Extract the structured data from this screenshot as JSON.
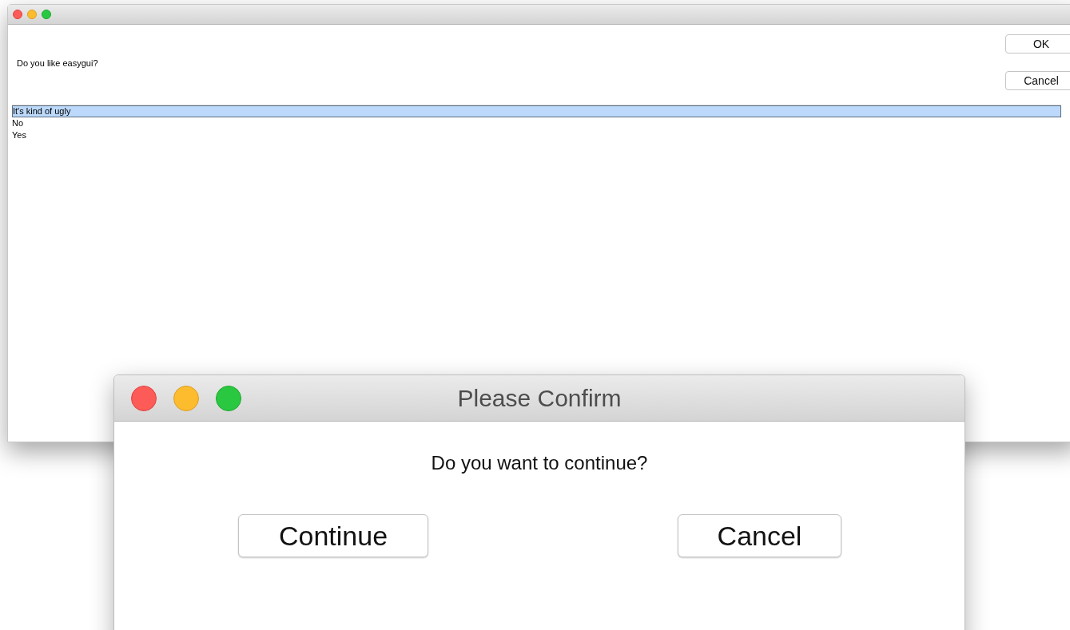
{
  "back_window": {
    "prompt": "Do you like easygui?",
    "buttons": [
      "OK",
      "Cancel"
    ],
    "choices": [
      {
        "label": "It's kind of ugly",
        "selected": true
      },
      {
        "label": "No",
        "selected": false
      },
      {
        "label": "Yes",
        "selected": false
      }
    ]
  },
  "dialog": {
    "title": "Please Confirm",
    "message": "Do you want to continue?",
    "buttons": [
      "Continue",
      "Cancel"
    ]
  }
}
